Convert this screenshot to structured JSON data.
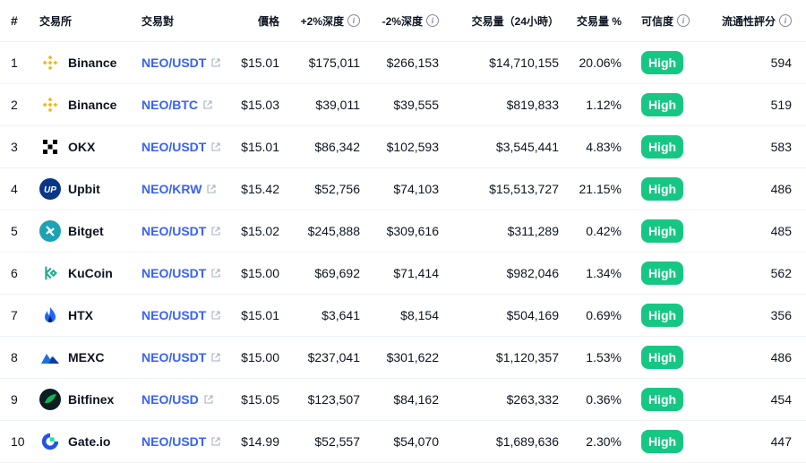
{
  "headers": {
    "rank": "#",
    "exchange": "交易所",
    "pair": "交易對",
    "price": "價格",
    "depth_up": "+2%深度",
    "depth_down": "-2%深度",
    "volume": "交易量（24小時）",
    "volume_pct": "交易量 %",
    "confidence": "可信度",
    "liquidity": "流通性評分"
  },
  "rows": [
    {
      "rank": "1",
      "exchange": "Binance",
      "logo": "binance-logo",
      "pair": "NEO/USDT",
      "price": "$15.01",
      "depth_up": "$175,011",
      "depth_down": "$266,153",
      "volume": "$14,710,155",
      "volume_pct": "20.06%",
      "confidence": "High",
      "liquidity": "594"
    },
    {
      "rank": "2",
      "exchange": "Binance",
      "logo": "binance-logo",
      "pair": "NEO/BTC",
      "price": "$15.03",
      "depth_up": "$39,011",
      "depth_down": "$39,555",
      "volume": "$819,833",
      "volume_pct": "1.12%",
      "confidence": "High",
      "liquidity": "519"
    },
    {
      "rank": "3",
      "exchange": "OKX",
      "logo": "okx-logo",
      "pair": "NEO/USDT",
      "price": "$15.01",
      "depth_up": "$86,342",
      "depth_down": "$102,593",
      "volume": "$3,545,441",
      "volume_pct": "4.83%",
      "confidence": "High",
      "liquidity": "583"
    },
    {
      "rank": "4",
      "exchange": "Upbit",
      "logo": "upbit-logo",
      "pair": "NEO/KRW",
      "price": "$15.42",
      "depth_up": "$52,756",
      "depth_down": "$74,103",
      "volume": "$15,513,727",
      "volume_pct": "21.15%",
      "confidence": "High",
      "liquidity": "486"
    },
    {
      "rank": "5",
      "exchange": "Bitget",
      "logo": "bitget-logo",
      "pair": "NEO/USDT",
      "price": "$15.02",
      "depth_up": "$245,888",
      "depth_down": "$309,616",
      "volume": "$311,289",
      "volume_pct": "0.42%",
      "confidence": "High",
      "liquidity": "485"
    },
    {
      "rank": "6",
      "exchange": "KuCoin",
      "logo": "kucoin-logo",
      "pair": "NEO/USDT",
      "price": "$15.00",
      "depth_up": "$69,692",
      "depth_down": "$71,414",
      "volume": "$982,046",
      "volume_pct": "1.34%",
      "confidence": "High",
      "liquidity": "562"
    },
    {
      "rank": "7",
      "exchange": "HTX",
      "logo": "htx-logo",
      "pair": "NEO/USDT",
      "price": "$15.01",
      "depth_up": "$3,641",
      "depth_down": "$8,154",
      "volume": "$504,169",
      "volume_pct": "0.69%",
      "confidence": "High",
      "liquidity": "356"
    },
    {
      "rank": "8",
      "exchange": "MEXC",
      "logo": "mexc-logo",
      "pair": "NEO/USDT",
      "price": "$15.00",
      "depth_up": "$237,041",
      "depth_down": "$301,622",
      "volume": "$1,120,357",
      "volume_pct": "1.53%",
      "confidence": "High",
      "liquidity": "486"
    },
    {
      "rank": "9",
      "exchange": "Bitfinex",
      "logo": "bitfinex-logo",
      "pair": "NEO/USD",
      "price": "$15.05",
      "depth_up": "$123,507",
      "depth_down": "$84,162",
      "volume": "$263,332",
      "volume_pct": "0.36%",
      "confidence": "High",
      "liquidity": "454"
    },
    {
      "rank": "10",
      "exchange": "Gate.io",
      "logo": "gateio-logo",
      "pair": "NEO/USDT",
      "price": "$14.99",
      "depth_up": "$52,557",
      "depth_down": "$54,070",
      "volume": "$1,689,636",
      "volume_pct": "2.30%",
      "confidence": "High",
      "liquidity": "447"
    }
  ],
  "colors": {
    "link": "#3861fb",
    "high_badge": "#16c784",
    "divider": "#eff2f5"
  }
}
